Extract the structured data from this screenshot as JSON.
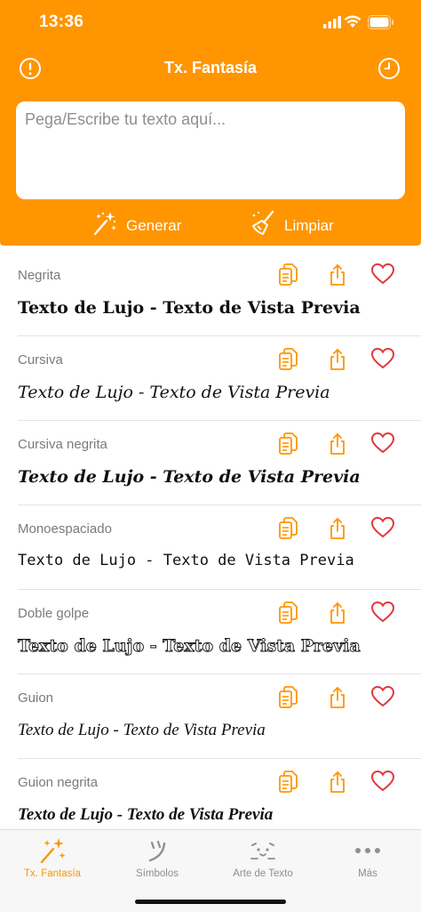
{
  "status_bar": {
    "time": "13:36"
  },
  "navbar": {
    "title": "Tx. Fantasía"
  },
  "input": {
    "placeholder": "Pega/Escribe tu texto aquí..."
  },
  "actions": {
    "generate_label": "Generar",
    "clear_label": "Limpiar"
  },
  "styles": [
    {
      "name": "Negrita",
      "preview": "Texto de Lujo - Texto de Vista Previa"
    },
    {
      "name": "Cursiva",
      "preview": "Texto de Lujo - Texto de Vista Previa"
    },
    {
      "name": "Cursiva negrita",
      "preview": "Texto de Lujo - Texto de Vista Previa"
    },
    {
      "name": "Monoespaciado",
      "preview": "Texto de Lujo - Texto de Vista Previa"
    },
    {
      "name": "Doble golpe",
      "preview": "Texto de Lujo - Texto de Vista Previa"
    },
    {
      "name": "Guion",
      "preview": "Texto de Lujo - Texto de Vista Previa"
    },
    {
      "name": "Guion negrita",
      "preview": "Texto de Lujo - Texto de Vista Previa"
    }
  ],
  "row_icons": [
    "copy-icon",
    "share-icon",
    "heart-icon"
  ],
  "tabs": [
    {
      "label": "Tx. Fantasía",
      "icon": "sparkles-icon",
      "active": true
    },
    {
      "label": "Símbolos",
      "icon": "symbols-icon",
      "active": false
    },
    {
      "label": "Arte de Texto",
      "icon": "text-art-icon",
      "active": false
    },
    {
      "label": "Más",
      "icon": "more-icon",
      "active": false
    }
  ],
  "colors": {
    "accent": "#FF9500",
    "heart": "#E0393E",
    "secondary_text": "#8E8E93"
  }
}
